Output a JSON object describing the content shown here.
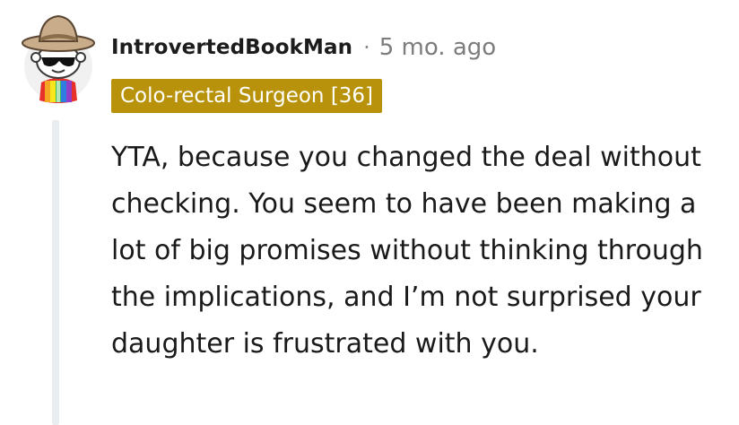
{
  "comment": {
    "author": "IntrovertedBookMan",
    "separator": "·",
    "time_ago": "5 mo. ago",
    "flair": "Colo-rectal Surgeon [36]",
    "body": "YTA, because you changed the deal without checking. You seem to have been making a lot of big promises without thinking through the implications, and I’m not surprised your daughter is frustrated with you."
  },
  "avatar": {
    "icon": "snoo-avatar-icon",
    "hat_color": "#c9ad8a",
    "face_color": "#ffffff",
    "shirt_colors": [
      "#e6322b",
      "#f5a623",
      "#f8e71c",
      "#3fbf4f",
      "#2f7de1",
      "#8e3ec9"
    ]
  },
  "colors": {
    "flair_bg": "#b8920a",
    "thread_line": "#e9edf0"
  }
}
